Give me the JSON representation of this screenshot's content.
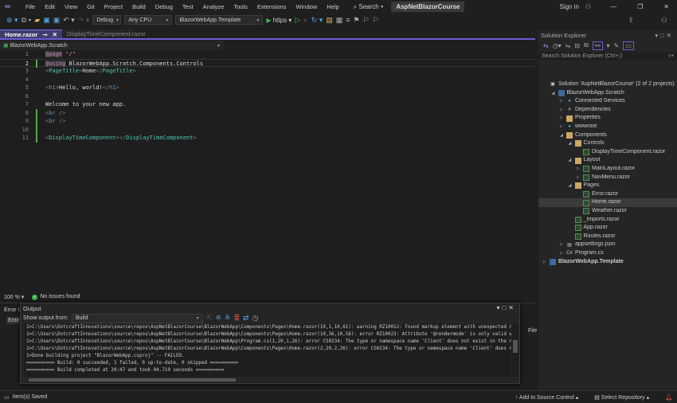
{
  "titlebar": {
    "menus": [
      "File",
      "Edit",
      "View",
      "Git",
      "Project",
      "Build",
      "Debug",
      "Test",
      "Analyze",
      "Tools",
      "Extensions",
      "Window",
      "Help"
    ],
    "search": "Search",
    "project": "AspNetBlazorCourse",
    "signin": "Sign in"
  },
  "toolbar": {
    "config": "Debug",
    "platform": "Any CPU",
    "startup": "BlazorWebApp.Template",
    "run": "https"
  },
  "tabs": [
    {
      "label": "Home.razor"
    },
    {
      "label": "DisplayTimeComponent.razor"
    }
  ],
  "navbar": {
    "project": "BlazorWebApp.Scratch"
  },
  "editor": {
    "lines": [
      "1",
      "2",
      "3",
      "4",
      "5",
      "6",
      "7",
      "8",
      "9",
      "10",
      "11"
    ],
    "code": {
      "l1a": "@page",
      "l1b": " \"/\"",
      "l2a": "@using",
      "l2b": " BlazorWebApp.Scratch.Components.Controls",
      "l3tag": "PageTitle",
      "l3txt": "Home",
      "l5tag": "h1",
      "l5txt": "Hello, world!",
      "l7": "Welcome to your new app.",
      "br": "br",
      "l11tag": "DisplayTimeComponent"
    },
    "zoom": "100 %",
    "issues": "No issues found"
  },
  "errorlist": {
    "title": "Error L",
    "scope": "Entir",
    "file_col": "File"
  },
  "output": {
    "title": "Output",
    "show_from_label": "Show output from:",
    "source": "Build",
    "lines": [
      "1>C:\\Users\\DotcraftInnovations\\source\\repos\\AspNetBlazorCourse\\BlazorWebApp\\Components\\Pages\\Home.razor(10,1,10,61): warning RZ10012: Found markup element with unexpected n",
      "1>C:\\Users\\DotcraftInnovations\\source\\repos\\AspNetBlazorCourse\\BlazorWebApp\\Components\\Pages\\Home.razor(10,36,10,58): error RZ10023: Attribute '@rendermode' is only valid w",
      "1>C:\\Users\\DotcraftInnovations\\source\\repos\\AspNetBlazorCourse\\BlazorWebApp\\Program.cs(1,20,1,26): error CS0234: The type or namespace name 'Client' does not exist in the n",
      "1>C:\\Users\\DotcraftInnovations\\source\\repos\\AspNetBlazorCourse\\BlazorWebApp\\Components\\Pages\\Home.razor(2,20,2,26): error CS0234: The type or namespace name 'Client' does n",
      "1>Done building project \"BlazorWebApp.csproj\" -- FAILED.",
      "========== Build: 0 succeeded, 1 failed, 0 up-to-date, 0 skipped ==========",
      "========== Build completed at 20:47 and took 04.719 seconds =========="
    ]
  },
  "statusbar": {
    "message": "Item(s) Saved",
    "source_control": "Add to Source Control",
    "repo": "Select Repository"
  },
  "solution_explorer": {
    "title": "Solution Explorer",
    "search_placeholder": "Search Solution Explorer (Ctrl+;)",
    "items": [
      {
        "label": "Solution 'AspNetBlazorCourse' (2 of 2 projects)"
      },
      {
        "label": "BlazorWebApp.Scratch"
      },
      {
        "label": "Connected Services"
      },
      {
        "label": "Dependencies"
      },
      {
        "label": "Properties"
      },
      {
        "label": "wwwroot"
      },
      {
        "label": "Components"
      },
      {
        "label": "Controls"
      },
      {
        "label": "DisplayTimeComponent.razor"
      },
      {
        "label": "Layout"
      },
      {
        "label": "MainLayout.razor"
      },
      {
        "label": "NavMenu.razor"
      },
      {
        "label": "Pages"
      },
      {
        "label": "Error.razor"
      },
      {
        "label": "Home.razor"
      },
      {
        "label": "Weather.razor"
      },
      {
        "label": "_Imports.razor"
      },
      {
        "label": "App.razor"
      },
      {
        "label": "Routes.razor"
      },
      {
        "label": "appsettings.json"
      },
      {
        "label": "Program.cs"
      },
      {
        "label": "BlazorWebApp.Template"
      }
    ]
  }
}
